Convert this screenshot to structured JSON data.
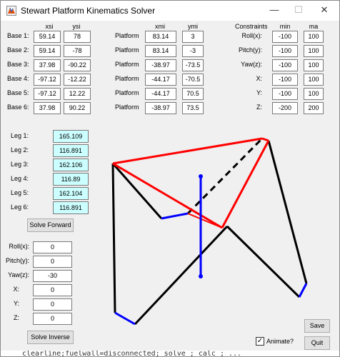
{
  "window": {
    "title": "Stewart Platform Kinematics Solver",
    "controls": {
      "minimize": "—",
      "maximize": "☐",
      "close": "✕"
    }
  },
  "base": {
    "header_x": "xsi",
    "header_y": "ysi",
    "rows": [
      {
        "label": "Base 1:",
        "x": "59.14",
        "y": "78"
      },
      {
        "label": "Base 2:",
        "x": "59.14",
        "y": "-78"
      },
      {
        "label": "Base 3:",
        "x": "37.98",
        "y": "-90.22"
      },
      {
        "label": "Base 4:",
        "x": "-97.12",
        "y": "-12.22"
      },
      {
        "label": "Base 5:",
        "x": "-97.12",
        "y": "12.22"
      },
      {
        "label": "Base 6:",
        "x": "37.98",
        "y": "90.22"
      }
    ]
  },
  "platform": {
    "header_x": "xmi",
    "header_y": "ymi",
    "rows": [
      {
        "label": "Platform",
        "x": "83.14",
        "y": "3"
      },
      {
        "label": "Platform",
        "x": "83.14",
        "y": "-3"
      },
      {
        "label": "Platform",
        "x": "-38.97",
        "y": "-73.5"
      },
      {
        "label": "Platform",
        "x": "-44.17",
        "y": "-70.5"
      },
      {
        "label": "Platform",
        "x": "-44.17",
        "y": "70.5"
      },
      {
        "label": "Platform",
        "x": "-38.97",
        "y": "73.5"
      }
    ]
  },
  "constraints": {
    "header": "Constraints",
    "header_min": "min",
    "header_max": "ma",
    "rows": [
      {
        "label": "Roll(x):",
        "min": "-100",
        "max": "100"
      },
      {
        "label": "Pitch(y):",
        "min": "-100",
        "max": "100"
      },
      {
        "label": "Yaw(z):",
        "min": "-100",
        "max": "100"
      },
      {
        "label": "X:",
        "min": "-100",
        "max": "100"
      },
      {
        "label": "Y:",
        "min": "-100",
        "max": "100"
      },
      {
        "label": "Z:",
        "min": "-200",
        "max": "200"
      }
    ]
  },
  "legs": [
    {
      "label": "Leg 1:",
      "value": "165.109"
    },
    {
      "label": "Leg 2:",
      "value": "116.891"
    },
    {
      "label": "Leg 3:",
      "value": "162.106"
    },
    {
      "label": "Leg 4:",
      "value": "116.89"
    },
    {
      "label": "Leg 5:",
      "value": "162.104"
    },
    {
      "label": "Leg 6:",
      "value": "116.891"
    }
  ],
  "solve_forward_label": "Solve Forward",
  "pose": [
    {
      "label": "Roll(x):",
      "value": "0"
    },
    {
      "label": "Pitch(y):",
      "value": "0"
    },
    {
      "label": "Yaw(z):",
      "value": "-30"
    },
    {
      "label": "X:",
      "value": "0"
    },
    {
      "label": "Y:",
      "value": "0"
    },
    {
      "label": "Z:",
      "value": "0"
    }
  ],
  "solve_inverse_label": "Solve Inverse",
  "save_label": "Save",
  "quit_label": "Quit",
  "animate": {
    "label": "Animate?",
    "checked": "✓"
  },
  "code_strip_text": "clearline;fuelwall=disconnected;  solve ; calc ; ...",
  "colors": {
    "platform": "#ff0000",
    "legs": "#000000",
    "base": "#0000ff",
    "axis": "#0000ff"
  }
}
